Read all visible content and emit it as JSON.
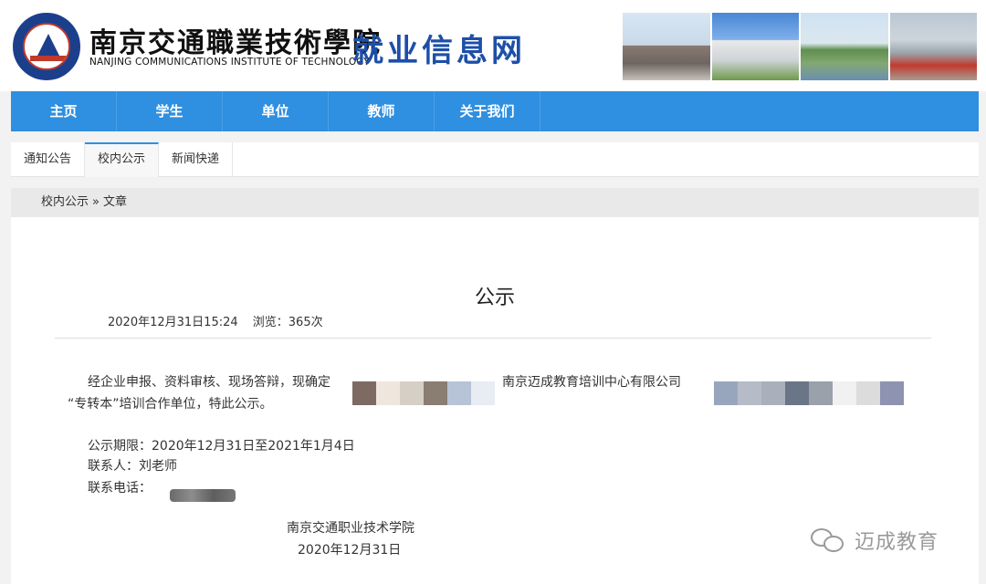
{
  "header": {
    "school_name_cn": "南京交通職業技術學院",
    "school_name_en": "NANJING COMMUNICATIONS INSTITUTE OF TECHNOLOGY",
    "site_name": "就业信息网"
  },
  "nav": {
    "items": [
      "主页",
      "学生",
      "单位",
      "教师",
      "关于我们"
    ]
  },
  "tabs": {
    "items": [
      "通知公告",
      "校内公示",
      "新闻快递"
    ],
    "active": "校内公示"
  },
  "breadcrumb": {
    "section": "校内公示",
    "separator": "»",
    "current": "文章"
  },
  "article": {
    "title": "公示",
    "datetime": "2020年12月31日15:24",
    "views": "浏览：365次",
    "para1_start": "经企业申报、资料审核、现场答辩，现确定",
    "para1_company": "南京迈成教育培训中心有限公司",
    "para1_end": "“专转本”培训合作单位，特此公示。",
    "period": "公示期限：2020年12月31日至2021年1月4日",
    "contact": "联系人：刘老师",
    "phone_label": "联系电话：",
    "signature_org": "南京交通职业技术学院",
    "signature_date": "2020年12月31日"
  },
  "watermark": {
    "text": "迈成教育"
  },
  "colors": {
    "nav_bg": "#2f8fe0",
    "site_name": "#1d4fa8",
    "page_bg": "#f2f2f2"
  }
}
